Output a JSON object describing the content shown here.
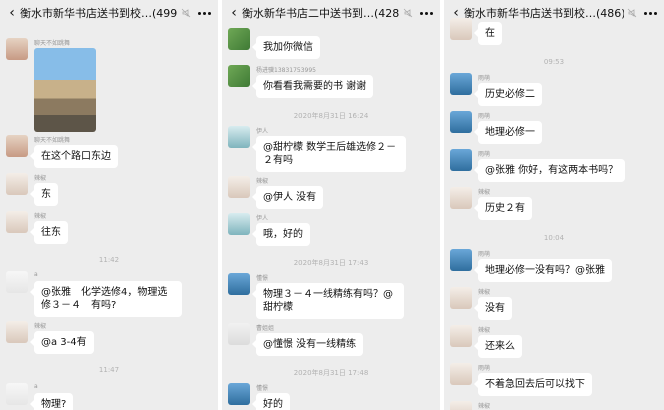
{
  "panels": [
    {
      "title": "衡水市新华书店送书到校…(499)"
    },
    {
      "title": "衡水新华书店二中送书到…(428)"
    },
    {
      "title": "衡水市新华书店送书到校…(486)"
    }
  ],
  "p1": {
    "m1_nick": "聊天不如跳舞",
    "m2_nick": "聊天不如跳舞",
    "m2_text": "在这个路口东边",
    "m3_nick": "辣椒",
    "m3_text": "东",
    "m4_nick": "辣椒",
    "m4_text": "往东",
    "t1": "11:42",
    "m5_nick": "a",
    "m5_text": "@张雅　化学选修4，物理选修３－４　有吗?",
    "m6_nick": "辣椒",
    "m6_text": "@a 3-4有",
    "t2": "11:47",
    "m7_nick": "a",
    "m7_text": "物理?"
  },
  "p2": {
    "m1_text": "我加你微信",
    "m2_nick": "杨进骥13831753995",
    "m2_text": "你看看我需要的书 谢谢",
    "t1": "2020年8月31日 16:24",
    "m3_nick": "伊人",
    "m3_text": "@甜柠檬 数学王后雄选修２－２有吗",
    "m4_nick": "辣椒",
    "m4_text": "@伊人 没有",
    "m5_nick": "伊人",
    "m5_text": "哦，好的",
    "t2": "2020年8月31日 17:43",
    "m6_nick": "懂憬",
    "m6_text": "物理３－４一线精练有吗？@甜柠檬",
    "m7_nick": "曹姐姐",
    "m7_text": "@懂憬 没有一线精练",
    "t3": "2020年8月31日 17:48",
    "m8_nick": "懂憬",
    "m8_text": "好的"
  },
  "p3": {
    "m1_text": "在",
    "t1": "09:53",
    "m2_nick": "雨萌",
    "m2_text": "历史必修二",
    "m3_nick": "雨萌",
    "m3_text": "地理必修一",
    "m4_nick": "雨萌",
    "m4_text": "@张雅 你好，有这两本书吗？",
    "m5_nick": "辣椒",
    "m5_text": "历史２有",
    "t2": "10:04",
    "m6_nick": "雨萌",
    "m6_text": "地理必修一没有吗？@张雅",
    "m7_nick": "辣椒",
    "m7_text": "没有",
    "m8_nick": "辣椒",
    "m8_text": "还来么",
    "m9_nick": "雨萌",
    "m9_text": "不着急回去后可以找下",
    "m10_nick": "辣椒"
  }
}
